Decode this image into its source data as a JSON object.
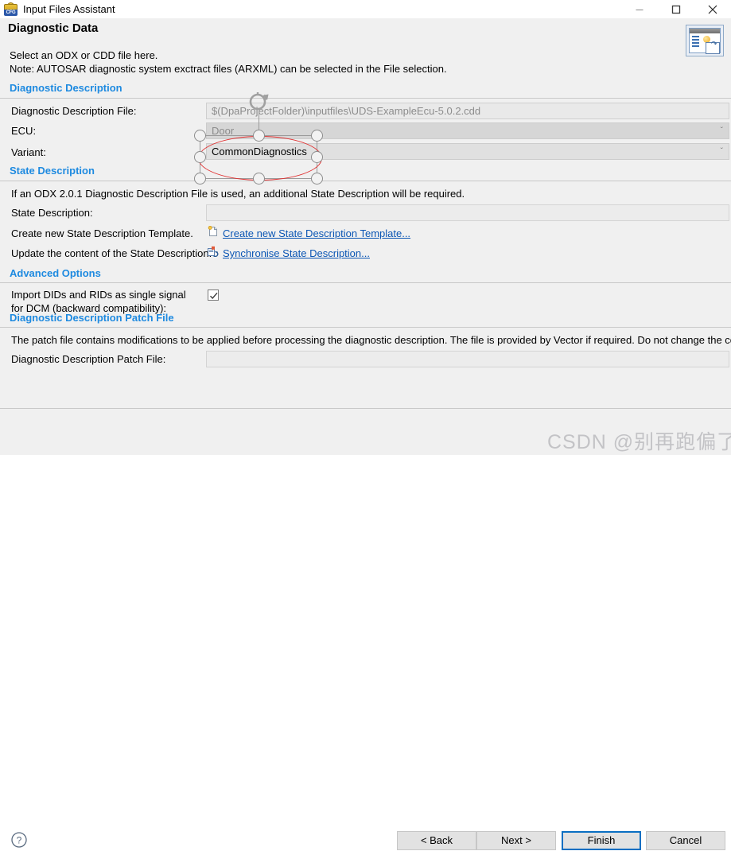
{
  "window": {
    "title": "Input Files Assistant",
    "app_icon": "cfg-icon",
    "minimize_label": "Minimize",
    "maximize_label": "Maximize",
    "close_label": "Close"
  },
  "header": {
    "page_title": "Diagnostic Data",
    "description_line1": "Select an ODX or CDD file here.",
    "description_line2": "Note: AUTOSAR diagnostic system exctract files (ARXML) can be selected in the File selection.",
    "wizard_icon": "wizard-page-icon"
  },
  "sections": {
    "diagnostic_description": "Diagnostic Description",
    "state_description": "State Description",
    "advanced_options": "Advanced Options",
    "patch_file": "Diagnostic Description Patch File"
  },
  "fields": {
    "ddfile_label": "Diagnostic Description File:",
    "ddfile_value": "$(DpaProjectFolder)\\inputfiles\\UDS-ExampleEcu-5.0.2.cdd",
    "ecu_label": "ECU:",
    "ecu_value": "Door",
    "variant_label": "Variant:",
    "variant_value": "CommonDiagnostics",
    "state_desc_label": "State Description:",
    "state_desc_value": "",
    "patch_label": "Diagnostic Description Patch File:",
    "patch_value": "",
    "chevron": "ˇ"
  },
  "state_description": {
    "note": "If an ODX 2.0.1 Diagnostic Description File is used, an additional State Description will be required.",
    "create_label": "Create new State Description Template.",
    "create_link": "Create new State Description Template...",
    "update_label": "Update the content of the State Description.",
    "update_link": "Synchronise State Description..."
  },
  "advanced": {
    "checkbox_label_line1": "Import DIDs and RIDs as single signal",
    "checkbox_label_line2": "for DCM (backward compatibility):",
    "checkbox_checked": true
  },
  "patch": {
    "note": "The patch file contains modifications to be applied before processing the diagnostic description. The file is provided by Vector if required. Do not change the content."
  },
  "footer": {
    "help_icon": "question-mark-icon",
    "back": "< Back",
    "next": "Next >",
    "finish": "Finish",
    "cancel": "Cancel"
  },
  "watermark": {
    "text": "CSDN @别再跑偏了"
  },
  "annotation": {
    "shape": "red-ellipse-selection",
    "accent_color": "#e03030",
    "handle_color": "#f2f2f2"
  },
  "colors": {
    "section_blue": "#1e8ae0",
    "link_blue": "#0b56b4",
    "primary_border": "#0a6fc2",
    "panel_bg": "#f0f0f0"
  }
}
